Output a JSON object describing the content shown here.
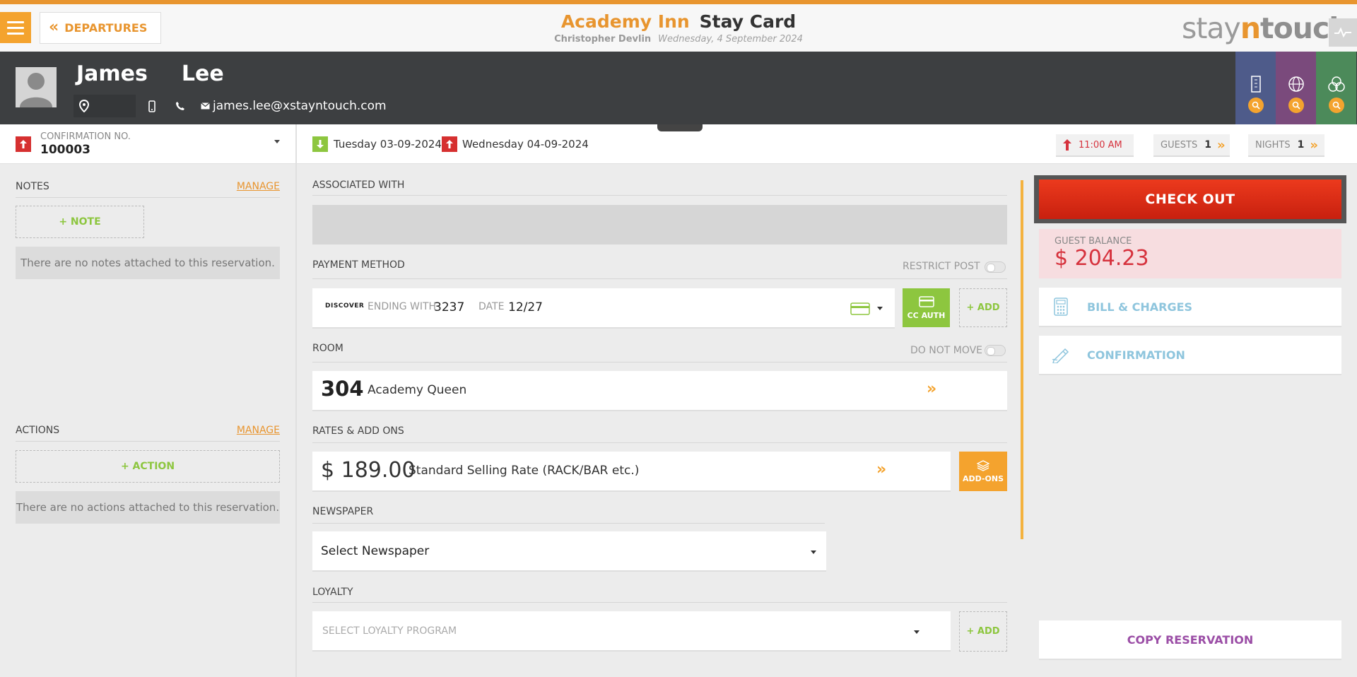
{
  "topbar": {
    "back_label": "DEPARTURES",
    "hotel_name": "Academy Inn",
    "page_title": "Stay Card",
    "user_name": "Christopher Devlin",
    "current_date": "Wednesday, 4 September 2024",
    "brand": {
      "part1": "stay",
      "part2": "n",
      "part3": "touch"
    }
  },
  "guest": {
    "first_name": "James",
    "last_name": "Lee",
    "email": "james.lee@xstayntouch.com"
  },
  "reservation": {
    "confirmation_label": "CONFIRMATION NO.",
    "confirmation_no": "100003",
    "arrival": "Tuesday 03-09-2024",
    "departure": "Wednesday 04-09-2024",
    "departure_time": "11:00 AM",
    "guests_label": "GUESTS",
    "guests_value": "1",
    "nights_label": "NIGHTS",
    "nights_value": "1"
  },
  "notes": {
    "title": "NOTES",
    "manage": "MANAGE",
    "add_label": "+ NOTE",
    "empty": "There are no notes attached to this reservation."
  },
  "actions": {
    "title": "ACTIONS",
    "manage": "MANAGE",
    "add_label": "+ ACTION",
    "empty": "There are no actions attached to this reservation."
  },
  "associated": {
    "title": "ASSOCIATED WITH"
  },
  "payment": {
    "title": "PAYMENT METHOD",
    "restrict_label": "RESTRICT POST",
    "card_brand": "DISCOVER",
    "ending_label": "ENDING WITH",
    "ending_value": "3237",
    "date_label": "DATE",
    "date_value": "12/27",
    "cc_auth_label": "CC AUTH",
    "add_label": "+ ADD"
  },
  "room": {
    "title": "ROOM",
    "do_not_move_label": "DO NOT MOVE",
    "number": "304",
    "type": "Academy Queen"
  },
  "rates": {
    "title": "RATES & ADD ONS",
    "amount": "$ 189.00",
    "name": "Standard Selling Rate (RACK/BAR etc.)",
    "addons_label": "ADD-ONS"
  },
  "newspaper": {
    "title": "NEWSPAPER",
    "selected": "Select Newspaper"
  },
  "loyalty": {
    "title": "LOYALTY",
    "placeholder": "SELECT LOYALTY PROGRAM",
    "add_label": "+ ADD"
  },
  "right": {
    "checkout_label": "CHECK OUT",
    "balance_label": "GUEST BALANCE",
    "balance_value": "$ 204.23",
    "bill_label": "BILL & CHARGES",
    "confirmation_label": "CONFIRMATION",
    "copy_label": "COPY RESERVATION"
  },
  "colors": {
    "accent": "#e8952f",
    "header_dark": "#3d3f41",
    "checkout_red": "#d9291a",
    "positive_green": "#8dc63f",
    "link_blue": "#8ec5dd",
    "copy_purple": "#9b4ea6"
  },
  "icons": {
    "menu": "hamburger-icon",
    "back": "double-chevron-left-icon",
    "location": "location-pin-icon",
    "mobile": "mobile-phone-icon",
    "phone": "phone-icon",
    "email": "envelope-icon",
    "bill": "calculator-icon",
    "confirmation": "pen-icon"
  }
}
